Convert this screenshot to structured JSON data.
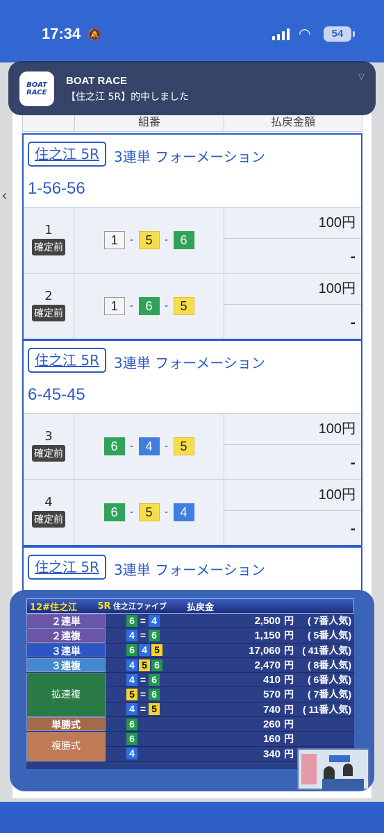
{
  "status": {
    "time": "17:34",
    "battery": "54"
  },
  "notification": {
    "app_name": "BOAT RACE",
    "message": "【住之江 5R】的中しました",
    "logo_line1": "BOAT",
    "logo_line2": "RACE"
  },
  "table_header": {
    "col_combo": "組番",
    "col_payout": "払戻金額"
  },
  "blocks": [
    {
      "venue": "住之江 5R",
      "type": "3連単 フォーメーション",
      "combo": "1-56-56",
      "rows": [
        {
          "no": "1",
          "status": "確定前",
          "boats": [
            "1",
            "5",
            "6"
          ],
          "amount": "100円",
          "payout": "-"
        },
        {
          "no": "2",
          "status": "確定前",
          "boats": [
            "1",
            "6",
            "5"
          ],
          "amount": "100円",
          "payout": "-"
        }
      ]
    },
    {
      "venue": "住之江 5R",
      "type": "3連単 フォーメーション",
      "combo": "6-45-45",
      "rows": [
        {
          "no": "3",
          "status": "確定前",
          "boats": [
            "6",
            "4",
            "5"
          ],
          "amount": "100円",
          "payout": "-"
        },
        {
          "no": "4",
          "status": "確定前",
          "boats": [
            "6",
            "5",
            "4"
          ],
          "amount": "100円",
          "payout": "-"
        }
      ]
    },
    {
      "venue": "住之江 5R",
      "type": "3連単 フォーメーション"
    }
  ],
  "results_board": {
    "header": {
      "venue": "12#住之江",
      "race": "5R",
      "title": "住之江ファイブ",
      "heading": "払戻金"
    },
    "rows": [
      {
        "label": "２連単",
        "boats": "6=4",
        "amount": "2,500",
        "yen": "円",
        "pop": "(  7番人気)"
      },
      {
        "label": "２連複",
        "boats": "4=6",
        "amount": "1,150",
        "yen": "円",
        "pop": "(  5番人気)"
      },
      {
        "label": "３連単",
        "boats": "645",
        "amount": "17,060",
        "yen": "円",
        "pop": "( 41番人気)"
      },
      {
        "label": "３連複",
        "boats": "456",
        "amount": "2,470",
        "yen": "円",
        "pop": "(  8番人気)"
      },
      {
        "label": "拡連複",
        "boats": "4=6",
        "amount": "410",
        "yen": "円",
        "pop": "(  6番人気)"
      },
      {
        "label": "",
        "boats": "5=6",
        "amount": "570",
        "yen": "円",
        "pop": "(  7番人気)"
      },
      {
        "label": "",
        "boats": "4=5",
        "amount": "740",
        "yen": "円",
        "pop": "( 11番人気)"
      },
      {
        "label": "単勝式",
        "boats": "6",
        "amount": "260",
        "yen": "円",
        "pop": ""
      },
      {
        "label": "複勝式",
        "boats": "6",
        "amount": "160",
        "yen": "円",
        "pop": ""
      },
      {
        "label": "",
        "boats": "4",
        "amount": "340",
        "yen": "円",
        "pop": ""
      }
    ]
  }
}
